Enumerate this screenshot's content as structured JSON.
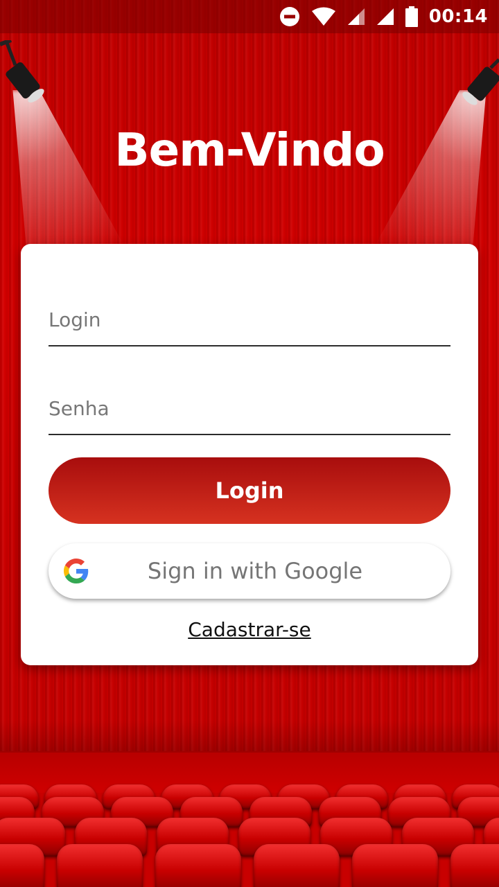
{
  "status_bar": {
    "time": "00:14",
    "icons": [
      "do-not-disturb-icon",
      "wifi-icon",
      "signal-icon",
      "signal-icon",
      "battery-icon"
    ]
  },
  "welcome": {
    "title": "Bem-Vindo"
  },
  "form": {
    "login_placeholder": "Login",
    "login_value": "",
    "password_placeholder": "Senha",
    "password_value": "",
    "login_button_label": "Login",
    "google_button_label": "Sign in with Google",
    "signup_link_label": "Cadastrar-se"
  },
  "colors": {
    "background": "#c80000",
    "login_button_top": "#a80d0d",
    "login_button_bottom": "#d63220",
    "google_blue": "#4285F4",
    "google_red": "#EA4335",
    "google_yellow": "#FBBC05",
    "google_green": "#34A853"
  }
}
